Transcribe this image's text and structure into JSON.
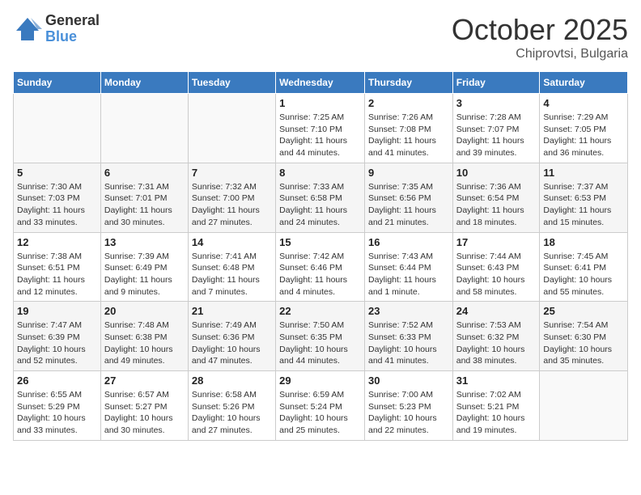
{
  "header": {
    "logo_general": "General",
    "logo_blue": "Blue",
    "month_year": "October 2025",
    "location": "Chiprovtsi, Bulgaria"
  },
  "weekdays": [
    "Sunday",
    "Monday",
    "Tuesday",
    "Wednesday",
    "Thursday",
    "Friday",
    "Saturday"
  ],
  "weeks": [
    [
      {
        "day": "",
        "sunrise": "",
        "sunset": "",
        "daylight": ""
      },
      {
        "day": "",
        "sunrise": "",
        "sunset": "",
        "daylight": ""
      },
      {
        "day": "",
        "sunrise": "",
        "sunset": "",
        "daylight": ""
      },
      {
        "day": "1",
        "sunrise": "Sunrise: 7:25 AM",
        "sunset": "Sunset: 7:10 PM",
        "daylight": "Daylight: 11 hours and 44 minutes."
      },
      {
        "day": "2",
        "sunrise": "Sunrise: 7:26 AM",
        "sunset": "Sunset: 7:08 PM",
        "daylight": "Daylight: 11 hours and 41 minutes."
      },
      {
        "day": "3",
        "sunrise": "Sunrise: 7:28 AM",
        "sunset": "Sunset: 7:07 PM",
        "daylight": "Daylight: 11 hours and 39 minutes."
      },
      {
        "day": "4",
        "sunrise": "Sunrise: 7:29 AM",
        "sunset": "Sunset: 7:05 PM",
        "daylight": "Daylight: 11 hours and 36 minutes."
      }
    ],
    [
      {
        "day": "5",
        "sunrise": "Sunrise: 7:30 AM",
        "sunset": "Sunset: 7:03 PM",
        "daylight": "Daylight: 11 hours and 33 minutes."
      },
      {
        "day": "6",
        "sunrise": "Sunrise: 7:31 AM",
        "sunset": "Sunset: 7:01 PM",
        "daylight": "Daylight: 11 hours and 30 minutes."
      },
      {
        "day": "7",
        "sunrise": "Sunrise: 7:32 AM",
        "sunset": "Sunset: 7:00 PM",
        "daylight": "Daylight: 11 hours and 27 minutes."
      },
      {
        "day": "8",
        "sunrise": "Sunrise: 7:33 AM",
        "sunset": "Sunset: 6:58 PM",
        "daylight": "Daylight: 11 hours and 24 minutes."
      },
      {
        "day": "9",
        "sunrise": "Sunrise: 7:35 AM",
        "sunset": "Sunset: 6:56 PM",
        "daylight": "Daylight: 11 hours and 21 minutes."
      },
      {
        "day": "10",
        "sunrise": "Sunrise: 7:36 AM",
        "sunset": "Sunset: 6:54 PM",
        "daylight": "Daylight: 11 hours and 18 minutes."
      },
      {
        "day": "11",
        "sunrise": "Sunrise: 7:37 AM",
        "sunset": "Sunset: 6:53 PM",
        "daylight": "Daylight: 11 hours and 15 minutes."
      }
    ],
    [
      {
        "day": "12",
        "sunrise": "Sunrise: 7:38 AM",
        "sunset": "Sunset: 6:51 PM",
        "daylight": "Daylight: 11 hours and 12 minutes."
      },
      {
        "day": "13",
        "sunrise": "Sunrise: 7:39 AM",
        "sunset": "Sunset: 6:49 PM",
        "daylight": "Daylight: 11 hours and 9 minutes."
      },
      {
        "day": "14",
        "sunrise": "Sunrise: 7:41 AM",
        "sunset": "Sunset: 6:48 PM",
        "daylight": "Daylight: 11 hours and 7 minutes."
      },
      {
        "day": "15",
        "sunrise": "Sunrise: 7:42 AM",
        "sunset": "Sunset: 6:46 PM",
        "daylight": "Daylight: 11 hours and 4 minutes."
      },
      {
        "day": "16",
        "sunrise": "Sunrise: 7:43 AM",
        "sunset": "Sunset: 6:44 PM",
        "daylight": "Daylight: 11 hours and 1 minute."
      },
      {
        "day": "17",
        "sunrise": "Sunrise: 7:44 AM",
        "sunset": "Sunset: 6:43 PM",
        "daylight": "Daylight: 10 hours and 58 minutes."
      },
      {
        "day": "18",
        "sunrise": "Sunrise: 7:45 AM",
        "sunset": "Sunset: 6:41 PM",
        "daylight": "Daylight: 10 hours and 55 minutes."
      }
    ],
    [
      {
        "day": "19",
        "sunrise": "Sunrise: 7:47 AM",
        "sunset": "Sunset: 6:39 PM",
        "daylight": "Daylight: 10 hours and 52 minutes."
      },
      {
        "day": "20",
        "sunrise": "Sunrise: 7:48 AM",
        "sunset": "Sunset: 6:38 PM",
        "daylight": "Daylight: 10 hours and 49 minutes."
      },
      {
        "day": "21",
        "sunrise": "Sunrise: 7:49 AM",
        "sunset": "Sunset: 6:36 PM",
        "daylight": "Daylight: 10 hours and 47 minutes."
      },
      {
        "day": "22",
        "sunrise": "Sunrise: 7:50 AM",
        "sunset": "Sunset: 6:35 PM",
        "daylight": "Daylight: 10 hours and 44 minutes."
      },
      {
        "day": "23",
        "sunrise": "Sunrise: 7:52 AM",
        "sunset": "Sunset: 6:33 PM",
        "daylight": "Daylight: 10 hours and 41 minutes."
      },
      {
        "day": "24",
        "sunrise": "Sunrise: 7:53 AM",
        "sunset": "Sunset: 6:32 PM",
        "daylight": "Daylight: 10 hours and 38 minutes."
      },
      {
        "day": "25",
        "sunrise": "Sunrise: 7:54 AM",
        "sunset": "Sunset: 6:30 PM",
        "daylight": "Daylight: 10 hours and 35 minutes."
      }
    ],
    [
      {
        "day": "26",
        "sunrise": "Sunrise: 6:55 AM",
        "sunset": "Sunset: 5:29 PM",
        "daylight": "Daylight: 10 hours and 33 minutes."
      },
      {
        "day": "27",
        "sunrise": "Sunrise: 6:57 AM",
        "sunset": "Sunset: 5:27 PM",
        "daylight": "Daylight: 10 hours and 30 minutes."
      },
      {
        "day": "28",
        "sunrise": "Sunrise: 6:58 AM",
        "sunset": "Sunset: 5:26 PM",
        "daylight": "Daylight: 10 hours and 27 minutes."
      },
      {
        "day": "29",
        "sunrise": "Sunrise: 6:59 AM",
        "sunset": "Sunset: 5:24 PM",
        "daylight": "Daylight: 10 hours and 25 minutes."
      },
      {
        "day": "30",
        "sunrise": "Sunrise: 7:00 AM",
        "sunset": "Sunset: 5:23 PM",
        "daylight": "Daylight: 10 hours and 22 minutes."
      },
      {
        "day": "31",
        "sunrise": "Sunrise: 7:02 AM",
        "sunset": "Sunset: 5:21 PM",
        "daylight": "Daylight: 10 hours and 19 minutes."
      },
      {
        "day": "",
        "sunrise": "",
        "sunset": "",
        "daylight": ""
      }
    ]
  ]
}
